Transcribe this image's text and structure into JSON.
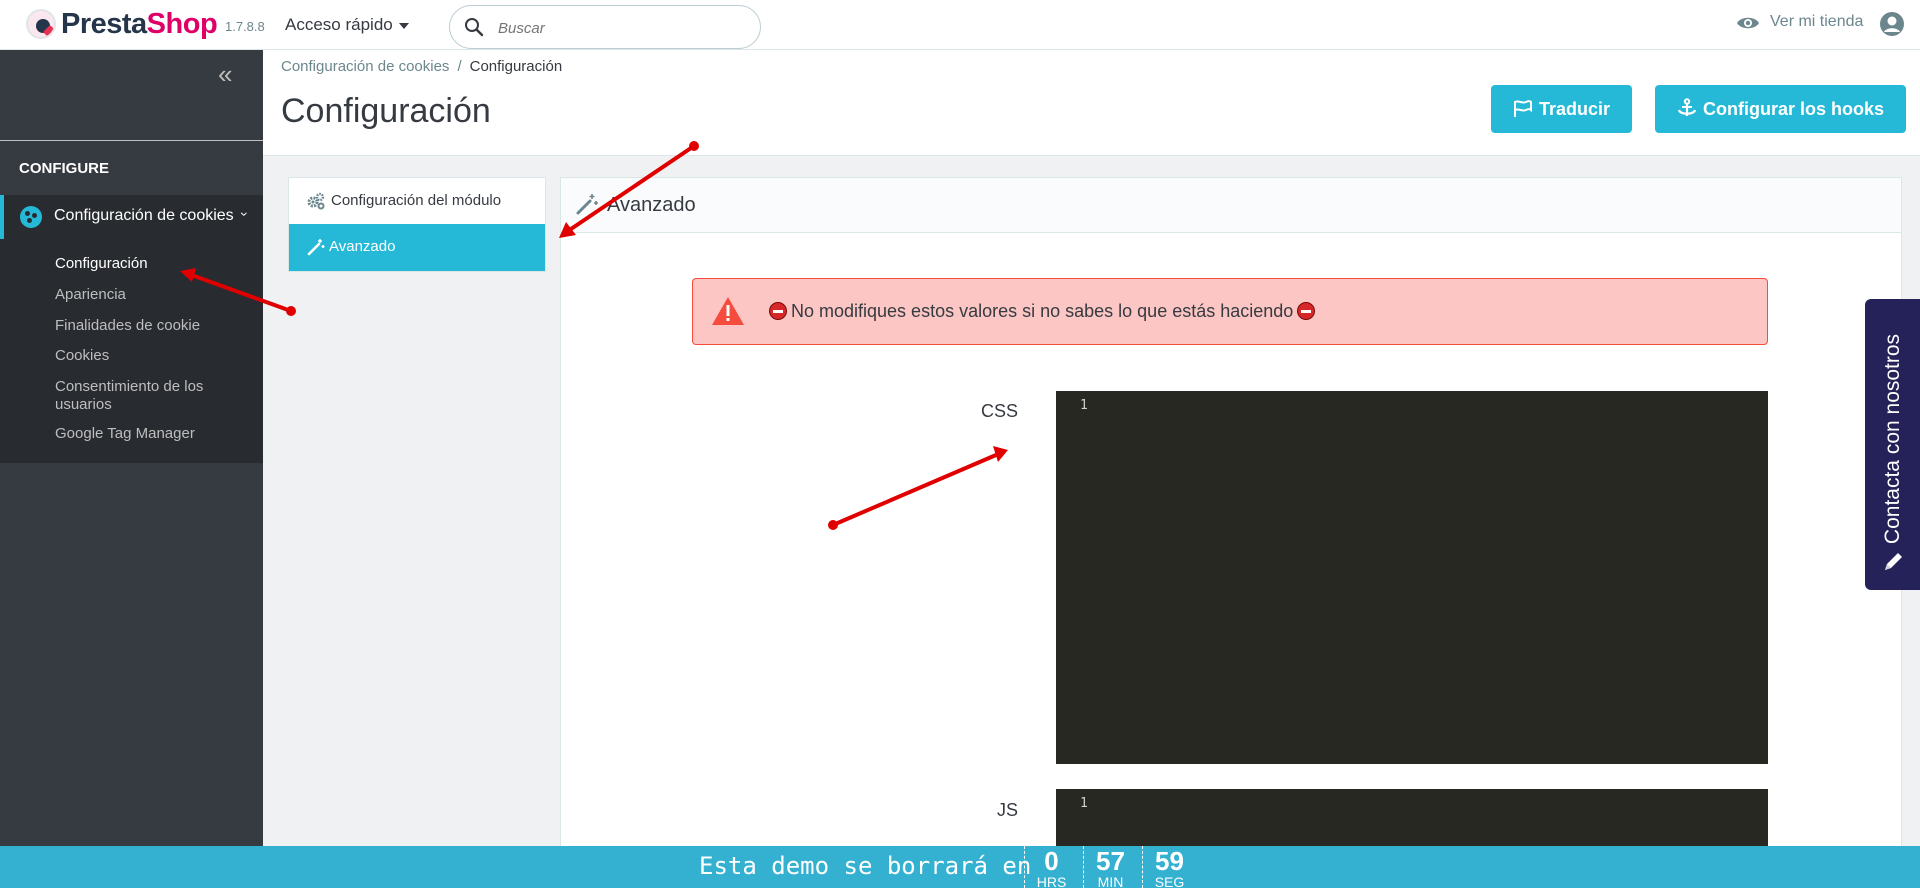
{
  "header": {
    "brand_part1": "Presta",
    "brand_part2": "Shop",
    "version": "1.7.8.8",
    "quick_access": "Acceso rápido",
    "search_placeholder": "Buscar",
    "view_store": "Ver mi tienda"
  },
  "sidebar": {
    "section_title": "CONFIGURE",
    "active_item": "Configuración de cookies",
    "sub_items": [
      "Configuración",
      "Apariencia",
      "Finalidades de cookie",
      "Cookies",
      "Consentimiento de los usuarios",
      "Google Tag Manager"
    ]
  },
  "breadcrumb": {
    "parent": "Configuración de cookies",
    "separator": "/",
    "current": "Configuración"
  },
  "page": {
    "title": "Configuración",
    "buttons": {
      "translate": "Traducir",
      "hooks": "Configurar los hooks"
    }
  },
  "tabs": [
    "Configuración del módulo",
    "Avanzado"
  ],
  "panel": {
    "title": "Avanzado",
    "alert": "No modifiques estos valores si no sabes lo que estás haciendo",
    "fields": [
      {
        "label": "CSS",
        "line_number": "1"
      },
      {
        "label": "JS",
        "line_number": "1"
      }
    ]
  },
  "contact_tab": "Contacta con nosotros",
  "bottom_bar": {
    "message": "Esta demo se borrará en",
    "hours": "0",
    "hours_label": "HRS",
    "minutes": "57",
    "minutes_label": "MIN",
    "seconds": "59",
    "seconds_label": "SEG"
  },
  "colors": {
    "accent": "#25b9d7",
    "sidebar": "#363a41",
    "alert_bg": "#fbc6c3",
    "editor_bg": "#272822",
    "contact_bg": "#25225a"
  }
}
